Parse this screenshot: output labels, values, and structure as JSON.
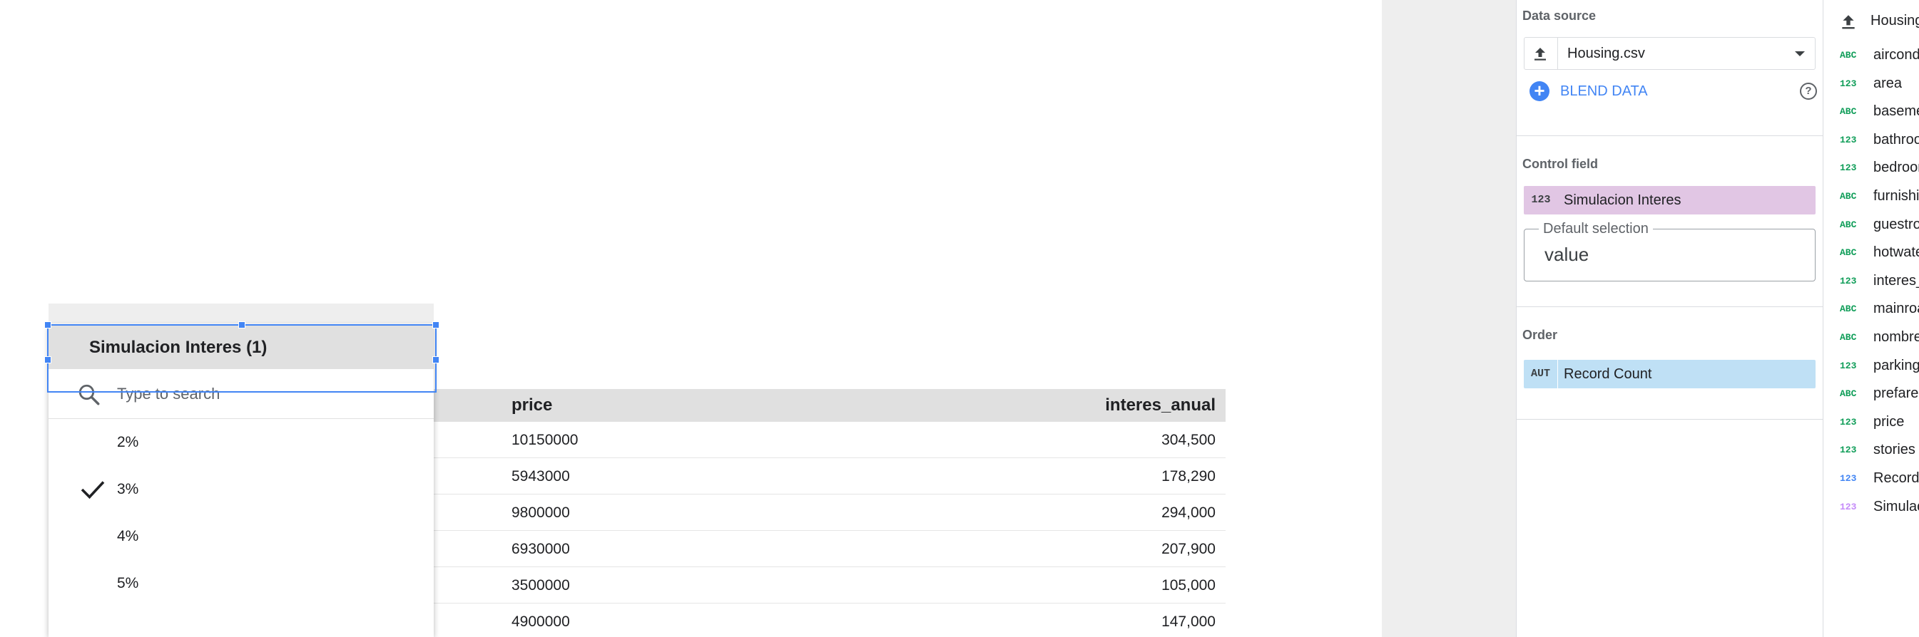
{
  "colors": {
    "accent_blue": "#4285f4",
    "dimension_green": "#0f9d58",
    "metric_blue": "#4285f4",
    "param_purple": "#c58af9",
    "control_field_chip": "#e1c6e4",
    "order_chip": "#bfe0f5"
  },
  "table": {
    "columns": [
      "price",
      "interes_anual"
    ],
    "rows": [
      {
        "price": "10150000",
        "interes_anual": "304,500"
      },
      {
        "price": "5943000",
        "interes_anual": "178,290"
      },
      {
        "price": "9800000",
        "interes_anual": "294,000"
      },
      {
        "price": "6930000",
        "interes_anual": "207,900"
      },
      {
        "price": "3500000",
        "interes_anual": "105,000"
      },
      {
        "price": "4900000",
        "interes_anual": "147,000"
      }
    ]
  },
  "filter_control": {
    "title": "Simulacion Interes (1)",
    "search_placeholder": "Type to search",
    "search_icon": "search-icon",
    "options": [
      {
        "label": "2%",
        "selected": false
      },
      {
        "label": "3%",
        "selected": true
      },
      {
        "label": "4%",
        "selected": false
      },
      {
        "label": "5%",
        "selected": false
      }
    ]
  },
  "properties": {
    "data_source": {
      "title": "Data source",
      "name": "Housing.csv",
      "blend_label": "BLEND DATA",
      "help_glyph": "?"
    },
    "control_field": {
      "title": "Control field",
      "field_type": "123",
      "field_name": "Simulacion Interes",
      "default_selection_label": "Default selection",
      "default_selection_value": "value"
    },
    "order": {
      "title": "Order",
      "field_type": "AUT",
      "field_name": "Record Count"
    }
  },
  "fields_panel": {
    "source_name": "Housing.csv",
    "fields": [
      {
        "type": "ABC",
        "name": "airconditioning",
        "color": "#0f9d58"
      },
      {
        "type": "123",
        "name": "area",
        "color": "#0f9d58"
      },
      {
        "type": "ABC",
        "name": "basement",
        "color": "#0f9d58"
      },
      {
        "type": "123",
        "name": "bathrooms",
        "color": "#0f9d58"
      },
      {
        "type": "123",
        "name": "bedrooms",
        "color": "#0f9d58"
      },
      {
        "type": "ABC",
        "name": "furnishingstatus",
        "color": "#0f9d58"
      },
      {
        "type": "ABC",
        "name": "guestroom",
        "color": "#0f9d58"
      },
      {
        "type": "ABC",
        "name": "hotwaterheating",
        "color": "#0f9d58"
      },
      {
        "type": "123",
        "name": "interes_anual",
        "color": "#0f9d58"
      },
      {
        "type": "ABC",
        "name": "mainroad",
        "color": "#0f9d58"
      },
      {
        "type": "ABC",
        "name": "nombre",
        "color": "#0f9d58"
      },
      {
        "type": "123",
        "name": "parking",
        "color": "#0f9d58"
      },
      {
        "type": "ABC",
        "name": "prefarea",
        "color": "#0f9d58"
      },
      {
        "type": "123",
        "name": "price",
        "color": "#0f9d58"
      },
      {
        "type": "123",
        "name": "stories",
        "color": "#0f9d58"
      },
      {
        "type": "123",
        "name": "Record Count",
        "color": "#4285f4"
      },
      {
        "type": "123",
        "name": "Simulacion Interes",
        "color": "#c58af9"
      }
    ]
  }
}
